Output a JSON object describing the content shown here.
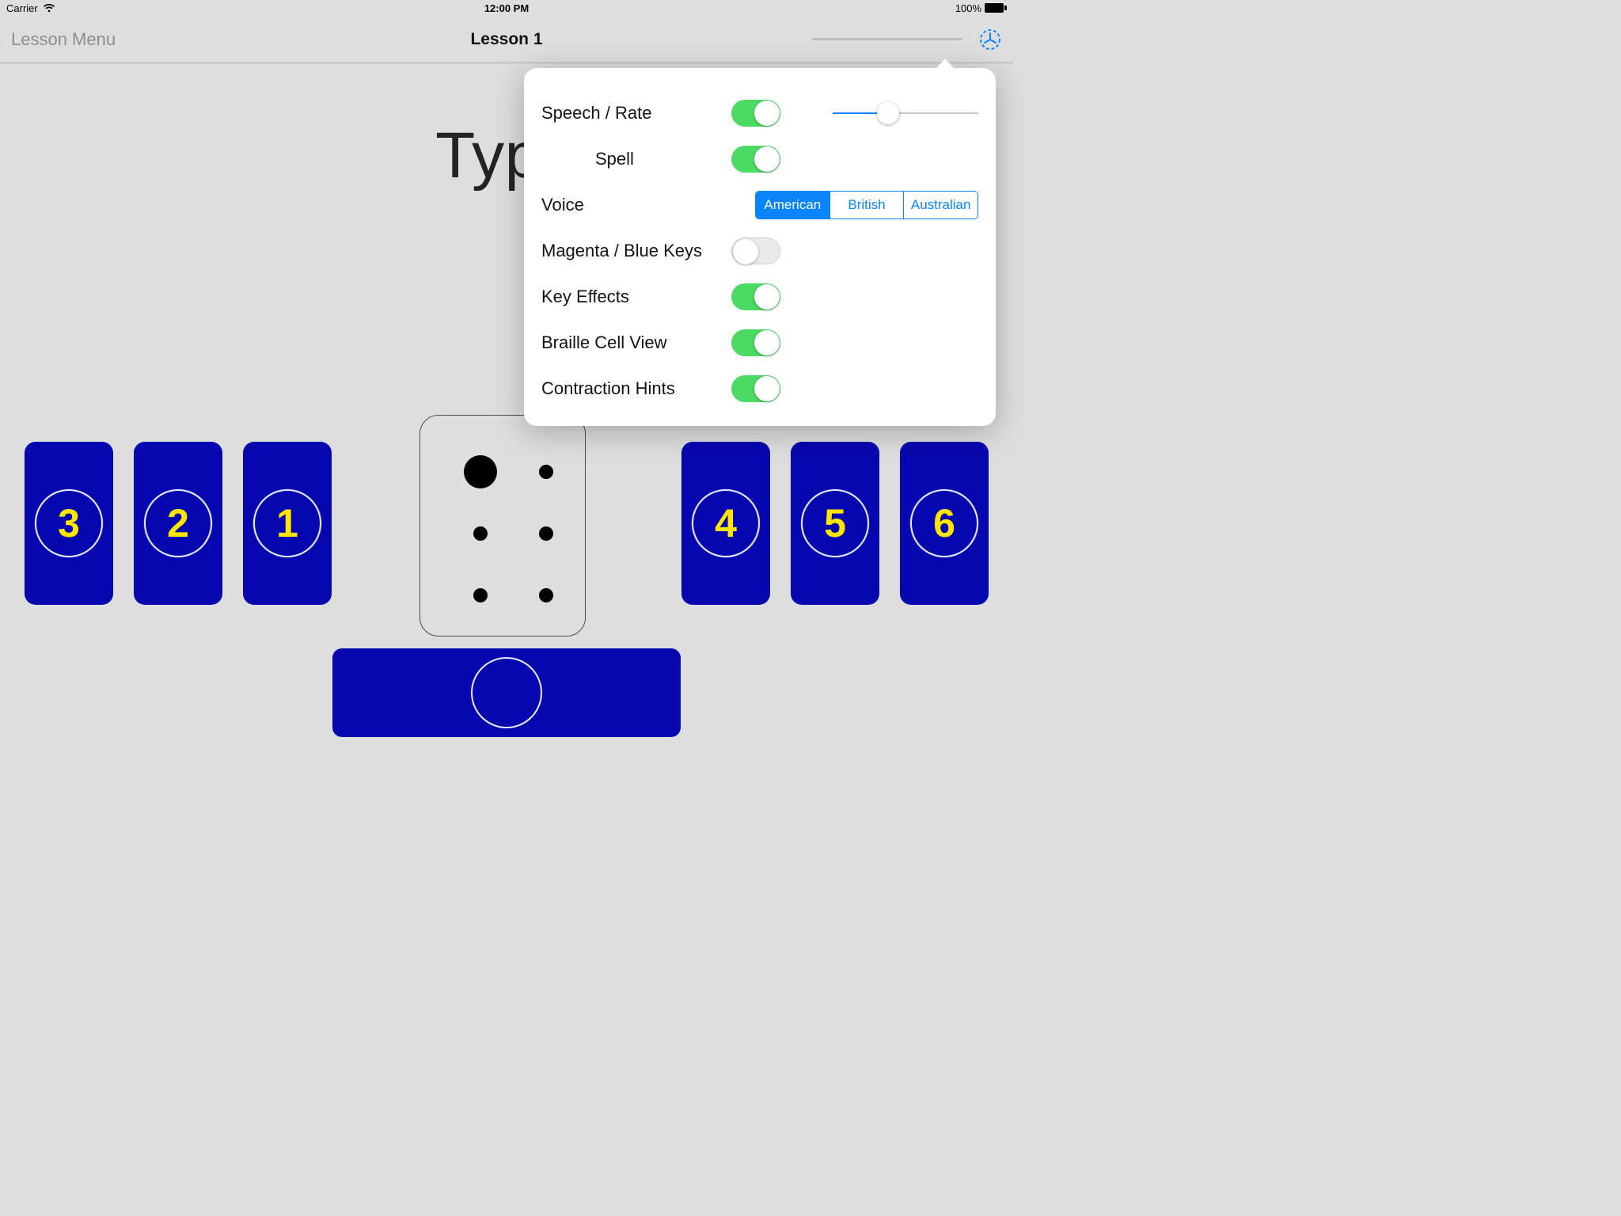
{
  "status": {
    "carrier": "Carrier",
    "time": "12:00 PM",
    "battery_pct": "100%"
  },
  "nav": {
    "back_label": "Lesson Menu",
    "title": "Lesson 1"
  },
  "main": {
    "big_text": "Type",
    "keys": {
      "k1": "1",
      "k2": "2",
      "k3": "3",
      "k4": "4",
      "k5": "5",
      "k6": "6"
    }
  },
  "settings": {
    "rows": {
      "speech_rate": {
        "label": "Speech / Rate",
        "on": true,
        "rate_pct": 38
      },
      "spell": {
        "label": "Spell",
        "on": true
      },
      "voice": {
        "label": "Voice",
        "options": [
          "American",
          "British",
          "Australian"
        ],
        "selected": "American"
      },
      "magenta_blue": {
        "label": "Magenta / Blue Keys",
        "on": false
      },
      "key_effects": {
        "label": "Key Effects",
        "on": true
      },
      "braille_view": {
        "label": "Braille Cell View",
        "on": true
      },
      "contraction": {
        "label": "Contraction Hints",
        "on": true
      }
    }
  }
}
